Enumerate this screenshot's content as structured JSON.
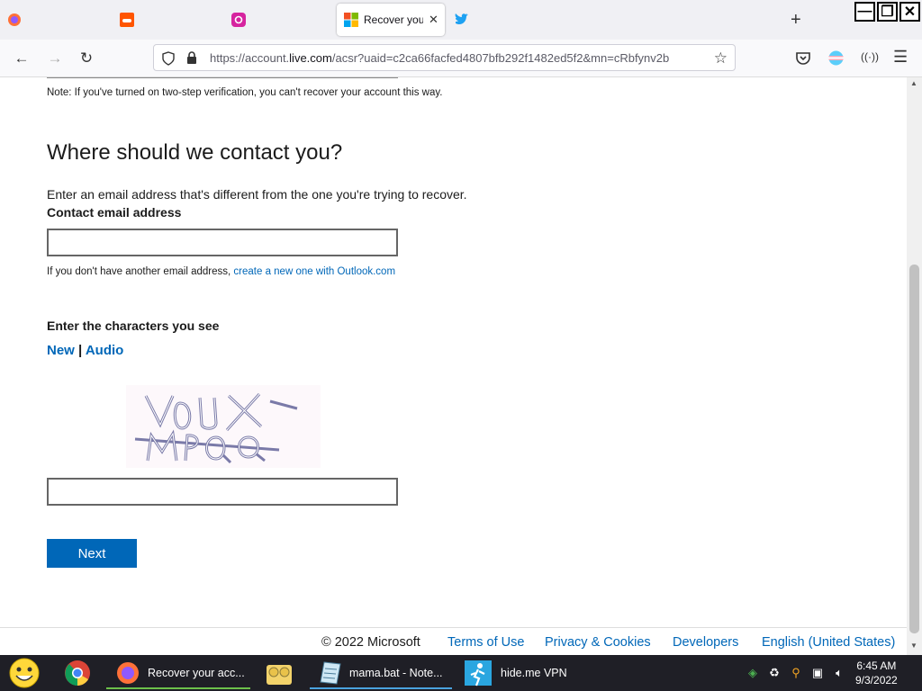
{
  "browser": {
    "active_tab_title": "Recover your account",
    "url_prefix": "https://account.",
    "url_domain": "live.com",
    "url_rest": "/acsr?uaid=c2ca66facfed4807bfb292f1482ed5f2&mn=cRbfynv2b"
  },
  "page": {
    "note": "Note: If you've turned on two-step verification, you can't recover your account this way.",
    "heading": "Where should we contact you?",
    "description": "Enter an email address that's different from the one you're trying to recover.",
    "contact_label": "Contact email address",
    "contact_value": "",
    "no_email_text": "If you don't have another email address, ",
    "no_email_link": "create a new one with Outlook.com",
    "captcha_heading": "Enter the characters you see",
    "captcha_new": "New",
    "captcha_sep": "|",
    "captcha_audio": "Audio",
    "captcha_value": "",
    "next_label": "Next"
  },
  "footer": {
    "copyright": "© 2022 Microsoft",
    "terms": "Terms of Use",
    "privacy": "Privacy & Cookies",
    "developers": "Developers",
    "language": "English (United States)"
  },
  "taskbar": {
    "items": [
      {
        "label": "Recover your acc..."
      },
      {
        "label": "mama.bat - Note..."
      },
      {
        "label": "hide.me VPN"
      }
    ],
    "time": "6:45 AM",
    "date": "9/3/2022"
  },
  "colors": {
    "link": "#0067b8",
    "button": "#0067b8",
    "taskbar": "#1f1f26"
  }
}
